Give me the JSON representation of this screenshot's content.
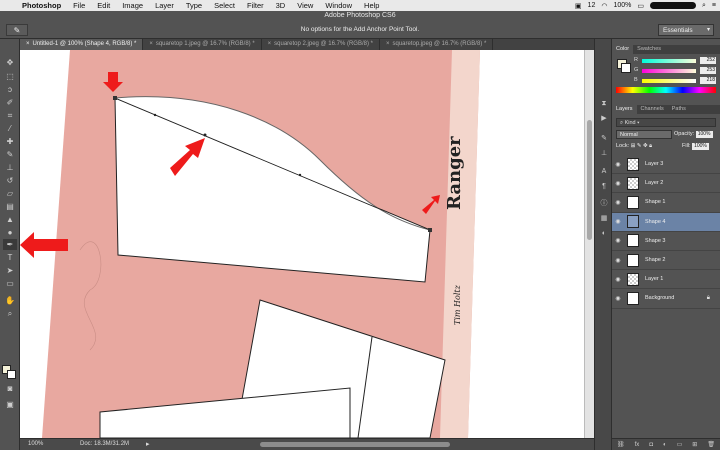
{
  "menubar": {
    "app": "Photoshop",
    "items": [
      "File",
      "Edit",
      "Image",
      "Layer",
      "Type",
      "Select",
      "Filter",
      "3D",
      "View",
      "Window",
      "Help"
    ],
    "status": {
      "notify": "12",
      "battery": "100%"
    }
  },
  "titlebar": {
    "title": "Adobe Photoshop CS6"
  },
  "options": {
    "hint": "No options for the Add Anchor Point Tool.",
    "workspace": "Essentials"
  },
  "tabs": [
    "Untitled-1 @ 100% (Shape 4, RGB/8) *",
    "squaretop 1.jpeg @ 16.7% (RGB/8) *",
    "squaretop 2.jpeg @ 16.7% (RGB/8) *",
    "squaretop.jpeg @ 16.7% (RGB/8) *"
  ],
  "status": {
    "zoom": "100%",
    "doc": "Doc: 18.3M/31.2M"
  },
  "color_panel": {
    "tabs": [
      "Color",
      "Swatches"
    ],
    "foreground": "#fcfdda",
    "channels": [
      {
        "label": "R",
        "value": "252"
      },
      {
        "label": "G",
        "value": "253"
      },
      {
        "label": "B",
        "value": "218"
      }
    ]
  },
  "layers_panel": {
    "tabs": [
      "Layers",
      "Channels",
      "Paths"
    ],
    "kind": "Kind",
    "blend_mode": "Normal",
    "opacity_label": "Opacity:",
    "opacity": "100%",
    "lock_label": "Lock:",
    "fill_label": "Fill:",
    "fill": "100%",
    "layers": [
      {
        "name": "Layer 3",
        "type": "pixel",
        "selected": false
      },
      {
        "name": "Layer 2",
        "type": "pixel",
        "selected": false
      },
      {
        "name": "Shape 1",
        "type": "shape",
        "selected": false
      },
      {
        "name": "Shape 4",
        "type": "shape",
        "selected": true
      },
      {
        "name": "Shape 3",
        "type": "shape",
        "selected": false
      },
      {
        "name": "Shape 2",
        "type": "shape",
        "selected": false
      },
      {
        "name": "Layer 1",
        "type": "pixel",
        "selected": false
      },
      {
        "name": "Background",
        "type": "background",
        "selected": false
      }
    ]
  },
  "canvas": {
    "paper_color": "#e8a8a0",
    "stamp_text": "Ranger",
    "stamp_text_2": "Tim Holtz"
  },
  "colors": {
    "accent": "#6b83a6",
    "arrow": "#ee1b1b"
  }
}
